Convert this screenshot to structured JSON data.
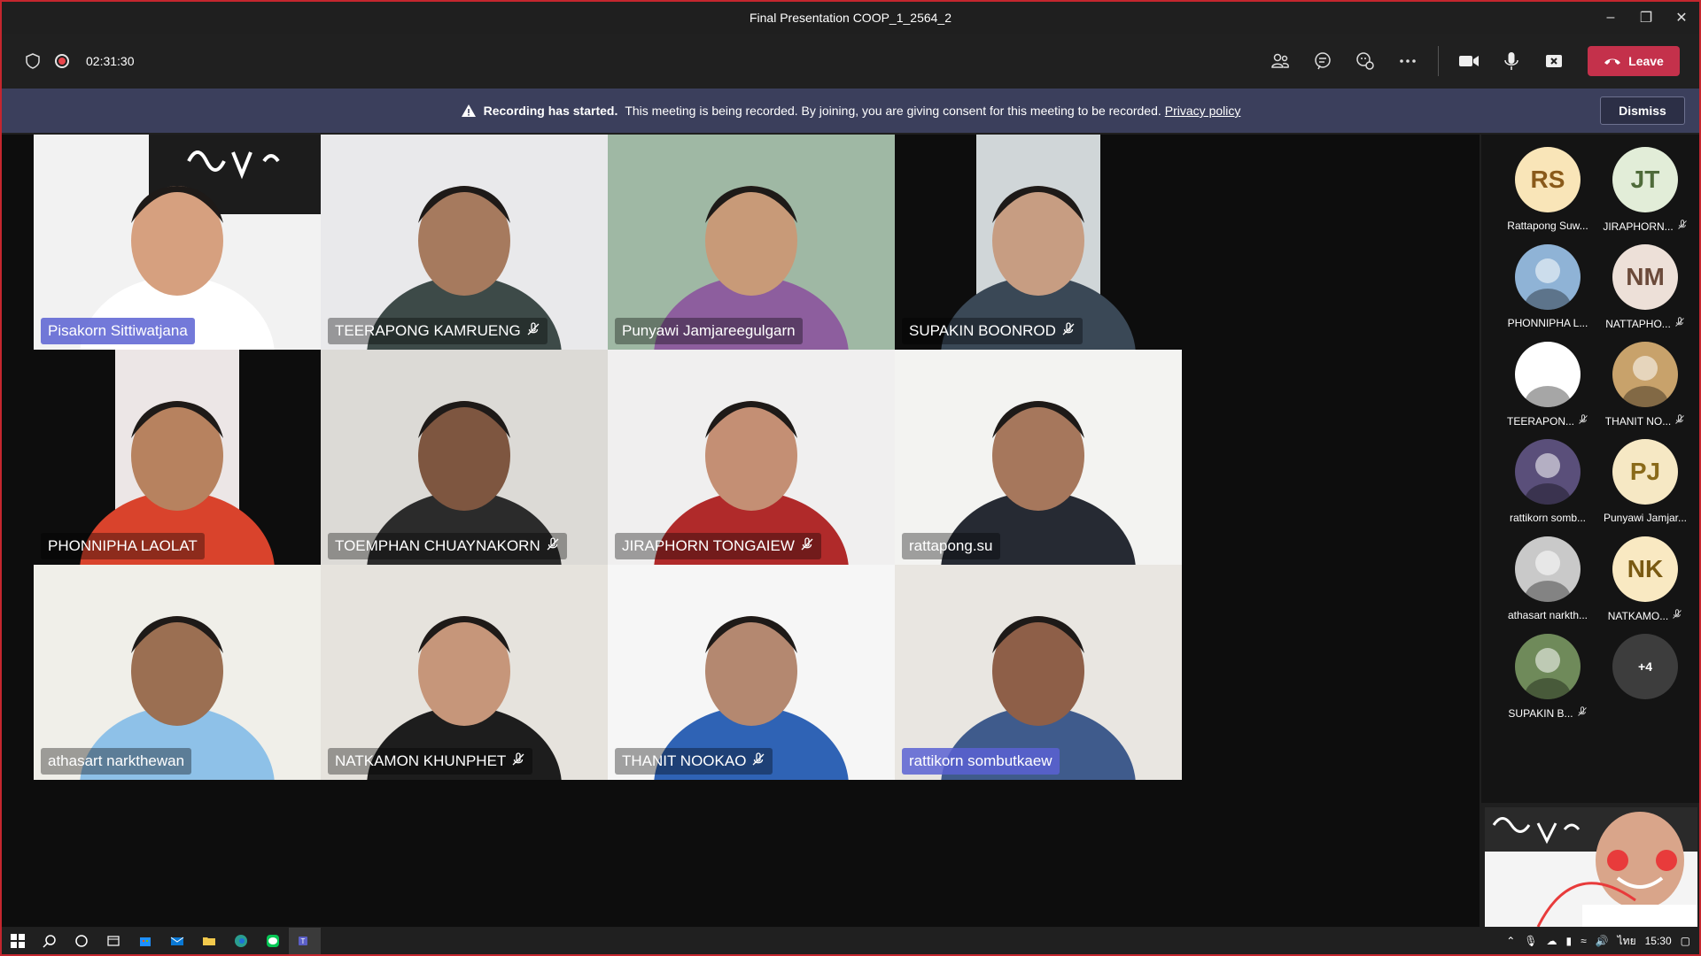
{
  "window": {
    "title": "Final Presentation COOP_1_2564_2",
    "controls": [
      "minimize-icon",
      "restore-icon",
      "close-icon"
    ]
  },
  "toolbar": {
    "timer": "02:31:30",
    "leave_label": "Leave",
    "icons": [
      "participants-icon",
      "chat-icon",
      "reactions-icon",
      "more-icon",
      "camera-icon",
      "microphone-icon",
      "share-icon"
    ]
  },
  "banner": {
    "title": "Recording has started.",
    "message": "This meeting is being recorded. By joining, you are giving consent for this meeting to be recorded.",
    "link": "Privacy policy",
    "dismiss_label": "Dismiss"
  },
  "tiles": [
    {
      "name": "Pisakorn Sittiwatjana",
      "muted": false,
      "pinned": true
    },
    {
      "name": "TEERAPONG KAMRUENG",
      "muted": true,
      "pinned": false
    },
    {
      "name": "Punyawi Jamjareegulgarn",
      "muted": false,
      "pinned": false
    },
    {
      "name": "SUPAKIN BOONROD",
      "muted": true,
      "pinned": false
    },
    {
      "name": "PHONNIPHA LAOLAT",
      "muted": false,
      "pinned": false
    },
    {
      "name": "TOEMPHAN CHUAYNAKORN",
      "muted": true,
      "pinned": false
    },
    {
      "name": "JIRAPHORN TONGAIEW",
      "muted": true,
      "pinned": false
    },
    {
      "name": "rattapong.su",
      "muted": false,
      "pinned": false
    },
    {
      "name": "athasart narkthewan",
      "muted": false,
      "pinned": false
    },
    {
      "name": "NATKAMON KHUNPHET",
      "muted": true,
      "pinned": false
    },
    {
      "name": "THANIT NOOKAO",
      "muted": true,
      "pinned": false
    },
    {
      "name": "rattikorn sombutkaew",
      "muted": false,
      "pinned": true
    }
  ],
  "participants": [
    {
      "initials": "RS",
      "name": "Rattapong Suw...",
      "muted": false,
      "color": "#f9e5b8",
      "text_color": "#8a5a1a"
    },
    {
      "initials": "JT",
      "name": "JIRAPHORN...",
      "muted": true,
      "color": "#e2edd8",
      "text_color": "#4f6b3a"
    },
    {
      "initials": "",
      "name": "PHONNIPHA L...",
      "muted": false,
      "color": "#8fb3d6",
      "text_color": "#fff"
    },
    {
      "initials": "NM",
      "name": "NATTAPHO...",
      "muted": true,
      "color": "#ede0d8",
      "text_color": "#6b4a3a"
    },
    {
      "initials": "",
      "name": "TEERAPON...",
      "muted": true,
      "color": "#ffffff",
      "text_color": "#c4262e"
    },
    {
      "initials": "",
      "name": "THANIT NO...",
      "muted": true,
      "color": "#c8a26b",
      "text_color": "#fff"
    },
    {
      "initials": "",
      "name": "rattikorn somb...",
      "muted": false,
      "color": "#5a4f7a",
      "text_color": "#fff"
    },
    {
      "initials": "PJ",
      "name": "Punyawi Jamjar...",
      "muted": false,
      "color": "#f6e8c4",
      "text_color": "#8a6a1a"
    },
    {
      "initials": "",
      "name": "athasart narkth...",
      "muted": false,
      "color": "#c9c9c9",
      "text_color": "#333"
    },
    {
      "initials": "NK",
      "name": "NATKAMO...",
      "muted": true,
      "color": "#f9e9c2",
      "text_color": "#7a5a12"
    },
    {
      "initials": "",
      "name": "SUPAKIN B...",
      "muted": true,
      "color": "#6f8a5a",
      "text_color": "#fff"
    },
    {
      "initials": "+4",
      "name": "",
      "muted": false,
      "color": "#3d3d3d",
      "text_color": "#fff"
    }
  ],
  "taskbar": {
    "time": "15:30",
    "lang": "ไทย"
  }
}
